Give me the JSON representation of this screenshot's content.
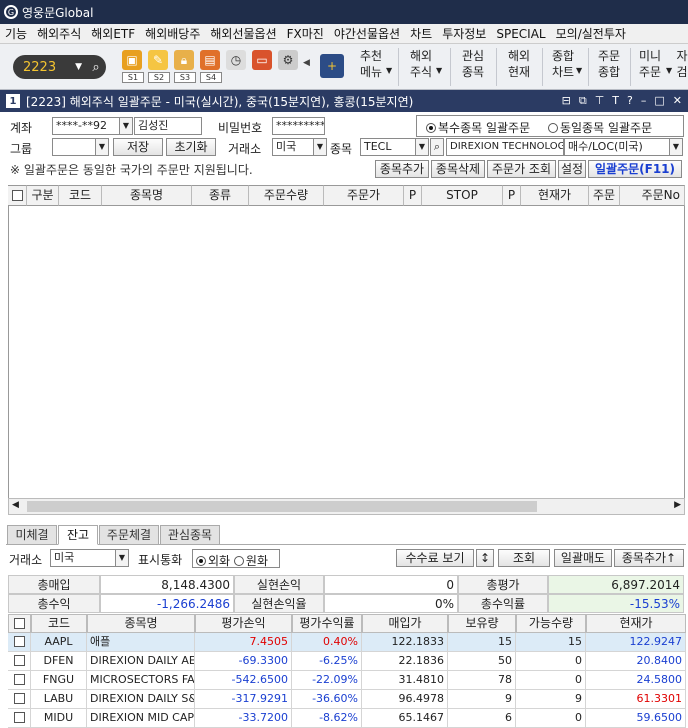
{
  "app": {
    "title": "영웅문Global"
  },
  "menu": [
    "기능",
    "해외주식",
    "해외ETF",
    "해외배당주",
    "해외선물옵션",
    "FX마진",
    "야간선물옵션",
    "차트",
    "투자정보",
    "SPECIAL",
    "모의/실전투자"
  ],
  "toolbar": {
    "screen_no": "2223",
    "sub_labels": [
      "S1",
      "S2",
      "S3",
      "S4"
    ],
    "buttons": [
      {
        "l1": "추천",
        "l2": "메뉴"
      },
      {
        "l1": "해외",
        "l2": "주식"
      },
      {
        "l1": "관심",
        "l2": "종목"
      },
      {
        "l1": "해외",
        "l2": "현재"
      },
      {
        "l1": "종합",
        "l2": "차트"
      },
      {
        "l1": "주문",
        "l2": "종합"
      },
      {
        "l1": "미니",
        "l2": "주문"
      },
      {
        "l1": "자",
        "l2": "검"
      }
    ]
  },
  "window": {
    "number": "1",
    "title": "[2223] 해외주식 일괄주문 - 미국(실시간), 중국(15분지연), 홍콩(15분지연)"
  },
  "form": {
    "account_label": "계좌",
    "account_value": "****-**92",
    "account_name": "김성진",
    "password_label": "비밀번호",
    "password_value": "*********",
    "mode_multi": "복수종목 일괄주문",
    "mode_same": "동일종목 일괄주문",
    "group_label": "그룹",
    "save_btn": "저장",
    "reset_btn": "초기화",
    "exchange_label": "거래소",
    "exchange_value": "미국",
    "stock_label": "종목",
    "stock_code": "TECL",
    "stock_name": "DIREXION TECHNOLOGY",
    "order_type": "매수/LOC(미국)",
    "notice": "※ 일괄주문은 동일한 국가의 주문만 지원됩니다.",
    "btn_add": "종목추가",
    "btn_del": "종목삭제",
    "btn_price": "주문가 조회",
    "btn_setting": "설정",
    "btn_batch": "일괄주문(F11)"
  },
  "order_grid": {
    "columns": [
      "구분",
      "코드",
      "종목명",
      "종류",
      "주문수량",
      "주문가",
      "P",
      "STOP",
      "P",
      "현재가",
      "주문",
      "주문No"
    ]
  },
  "tabs": [
    "미체결",
    "잔고",
    "주문체결",
    "관심종목"
  ],
  "balance": {
    "exchange_label": "거래소",
    "exchange_value": "미국",
    "currency_label": "표시통화",
    "fx_foreign": "외화",
    "fx_won": "원화",
    "btn_fee": "수수료 보기",
    "btn_sort": "↕",
    "btn_query": "조회",
    "btn_sell": "일괄매도",
    "btn_add": "종목추가↑",
    "summary": [
      {
        "label": "총매입",
        "value": "8,148.4300",
        "label2": "실현손익",
        "value2": "0",
        "label3": "총평가",
        "value3": "6,897.2014"
      },
      {
        "label": "총수익",
        "value": "-1,266.2486",
        "label2": "실현손익율",
        "value2": "0%",
        "label3": "총수익률",
        "value3": "-15.53%"
      }
    ],
    "columns": [
      "코드",
      "종목명",
      "평가손익",
      "평가수익률",
      "매입가",
      "보유량",
      "가능수량",
      "현재가"
    ],
    "rows": [
      {
        "code": "AAPL",
        "name": "애플",
        "pnl": "7.4505",
        "rate": "0.40%",
        "buy": "122.1833",
        "qty": "15",
        "avail": "15",
        "price": "122.9247",
        "dir": "up"
      },
      {
        "code": "DFEN",
        "name": "DIREXION DAILY AER",
        "pnl": "-69.3300",
        "rate": "-6.25%",
        "buy": "22.1836",
        "qty": "50",
        "avail": "0",
        "price": "20.8400",
        "dir": "down"
      },
      {
        "code": "FNGU",
        "name": "MICROSECTORS FANG",
        "pnl": "-542.6500",
        "rate": "-22.09%",
        "buy": "31.4810",
        "qty": "78",
        "avail": "0",
        "price": "24.5800",
        "dir": "down"
      },
      {
        "code": "LABU",
        "name": "DIREXION DAILY S&P",
        "pnl": "-317.9291",
        "rate": "-36.60%",
        "buy": "96.4978",
        "qty": "9",
        "avail": "9",
        "price": "61.3301",
        "dir": "down"
      },
      {
        "code": "MIDU",
        "name": "DIREXION MID CAP B",
        "pnl": "-33.7200",
        "rate": "-8.62%",
        "buy": "65.1467",
        "qty": "6",
        "avail": "0",
        "price": "59.6500",
        "dir": "down"
      }
    ]
  }
}
